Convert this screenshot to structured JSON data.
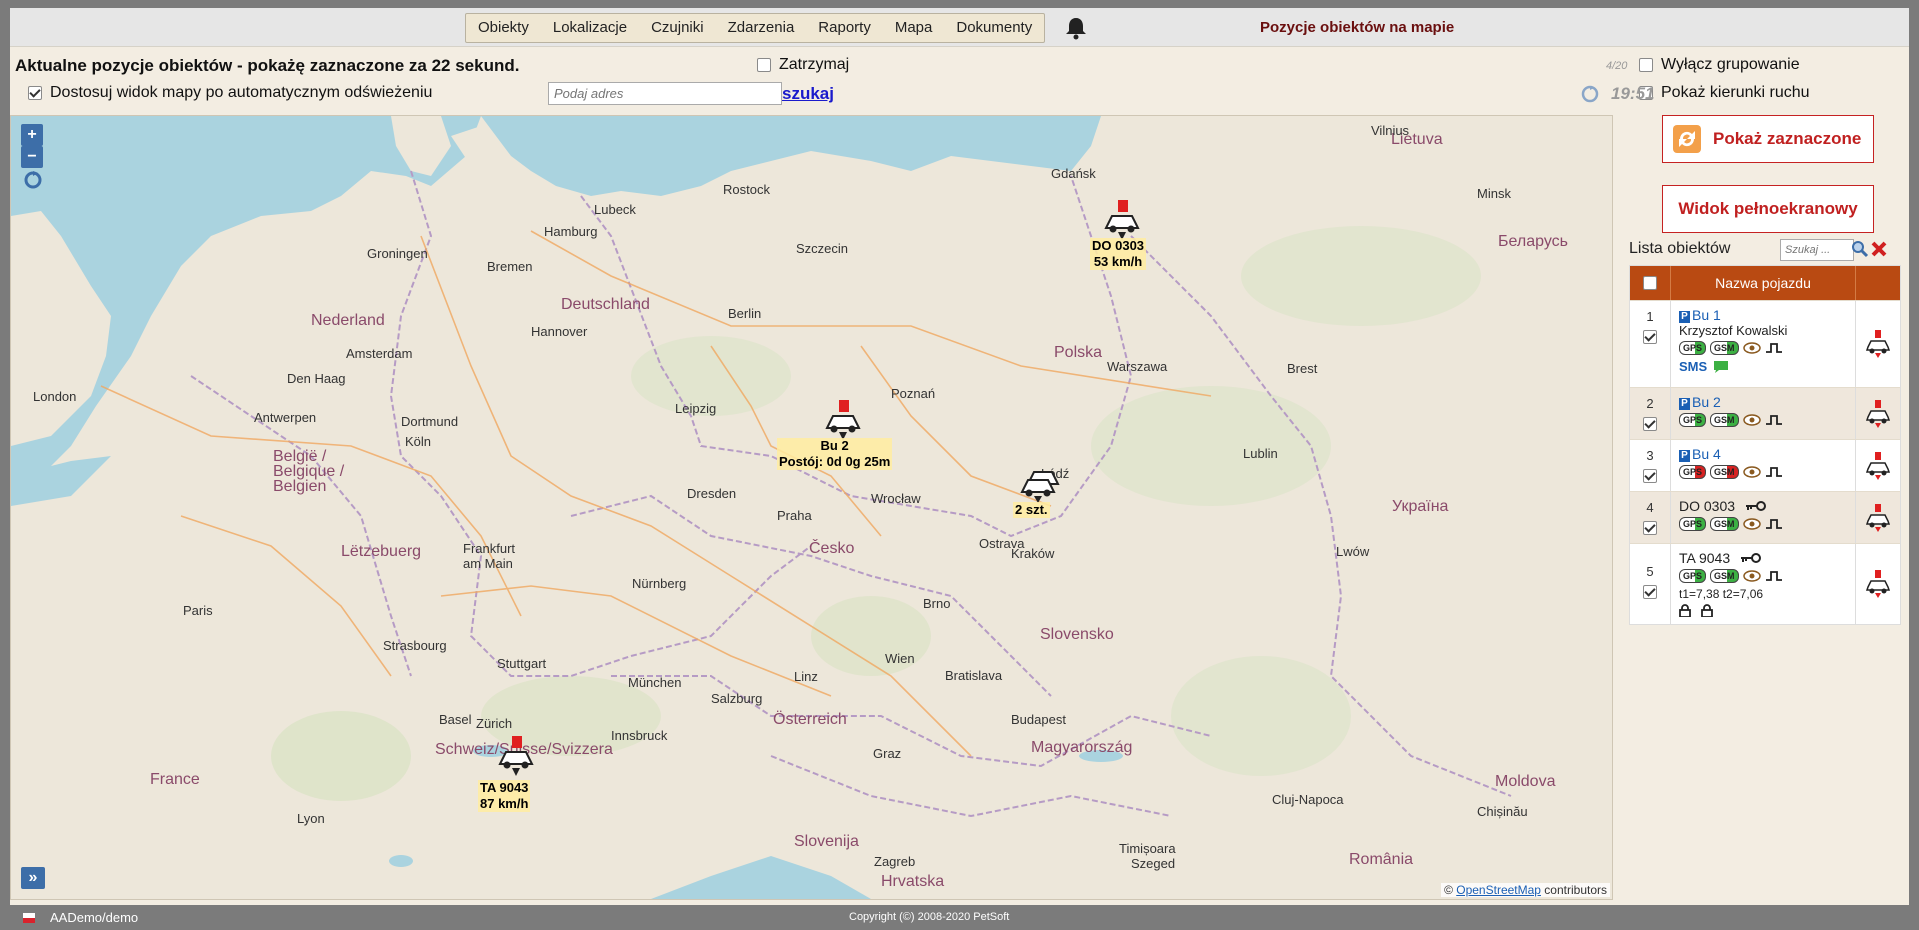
{
  "menu": [
    "Obiekty",
    "Lokalizacje",
    "Czujniki",
    "Zdarzenia",
    "Raporty",
    "Mapa",
    "Dokumenty"
  ],
  "page_title": "Pozycje obiektów na mapie",
  "headline": "Aktualne pozycje obiektów - pokażę zaznaczone za 22 sekund.",
  "options": {
    "stop": "Zatrzymaj",
    "fit_view": "Dostosuj widok mapy po automatycznym odświeżeniu",
    "disable_grouping": "Wyłącz grupowanie",
    "show_directions": "Pokaż kierunki ruchu"
  },
  "address": {
    "placeholder": "Podaj adres",
    "search_label": "szukaj"
  },
  "counter": "4/20",
  "clock": "19:51",
  "buttons": {
    "show_selected": "Pokaż zaznaczone",
    "fullscreen": "Widok pełnoekranowy"
  },
  "list": {
    "title": "Lista obiektów",
    "search_placeholder": "Szukaj ...",
    "column": "Nazwa pojazdu",
    "rows": [
      {
        "num": "1",
        "name": "Bu 1",
        "driver": "Krzysztof Kowalski",
        "gps": "GPS",
        "gsm": "GSM",
        "sms": "SMS"
      },
      {
        "num": "2",
        "name": "Bu 2",
        "gps": "GPS",
        "gsm": "GSM"
      },
      {
        "num": "3",
        "name": "Bu 4",
        "gps": "GPS",
        "gsm": "GSM"
      },
      {
        "num": "4",
        "name": "DO 0303",
        "gps": "GPS",
        "gsm": "GSM"
      },
      {
        "num": "5",
        "name": "TA 9043",
        "gps": "GPS",
        "gsm": "GSM",
        "temps": "t1=7,38  t2=7,06"
      }
    ]
  },
  "map": {
    "vehicles": [
      {
        "line1": "DO 0303",
        "line2": "53 km/h"
      },
      {
        "line1": "Bu 2",
        "line2": "Postój: 0d 0g 25m"
      },
      {
        "line1": "2 szt.",
        "line2": ""
      },
      {
        "line1": "TA 9043",
        "line2": "87 km/h"
      }
    ],
    "countries": [
      "Deutschland",
      "Polska",
      "Česko",
      "Slovensko",
      "Österreich",
      "Magyarország",
      "Nederland",
      "België / Belgique / Belgien",
      "Lëtzebuerg",
      "France",
      "Schweiz/Suisse/Svizzera",
      "Slovenija",
      "Hrvatska",
      "Беларусь",
      "Україна",
      "România",
      "Moldova",
      "Lietuva"
    ],
    "cities": [
      "Hamburg",
      "Berlin",
      "Warszawa",
      "Bremen",
      "Groningen",
      "Den Haag",
      "Amsterdam",
      "Antwerpen",
      "London",
      "Leipzig",
      "Köln",
      "Frankfurt am Main",
      "Nürnberg",
      "München",
      "Wien",
      "Bratislava",
      "Budapest",
      "Praha",
      "Paris",
      "Strasbourg",
      "Lyon",
      "Zagreb",
      "Graz",
      "Kraków",
      "Łódź",
      "Poznań",
      "Wrocław",
      "Gdańsk",
      "Szczecin",
      "Lublin",
      "Brest",
      "Minsk",
      "Vilnius",
      "Lwów",
      "Cluj-Napoca",
      "Chișinău",
      "Szeged",
      "Timișoara",
      "Ostrava",
      "Brno",
      "Linz",
      "Salzburg",
      "Innsbruck",
      "Zürich",
      "Basel",
      "Stuttgart",
      "Dresden",
      "Hannover",
      "Dortmund",
      "Rostock",
      "Lubeck"
    ],
    "attribution_link": "OpenStreetMap",
    "attribution_suffix": " contributors"
  },
  "footer": {
    "user": "AADemo/demo",
    "copyright": "Copyright (©) 2008-2020 PetSoft"
  }
}
